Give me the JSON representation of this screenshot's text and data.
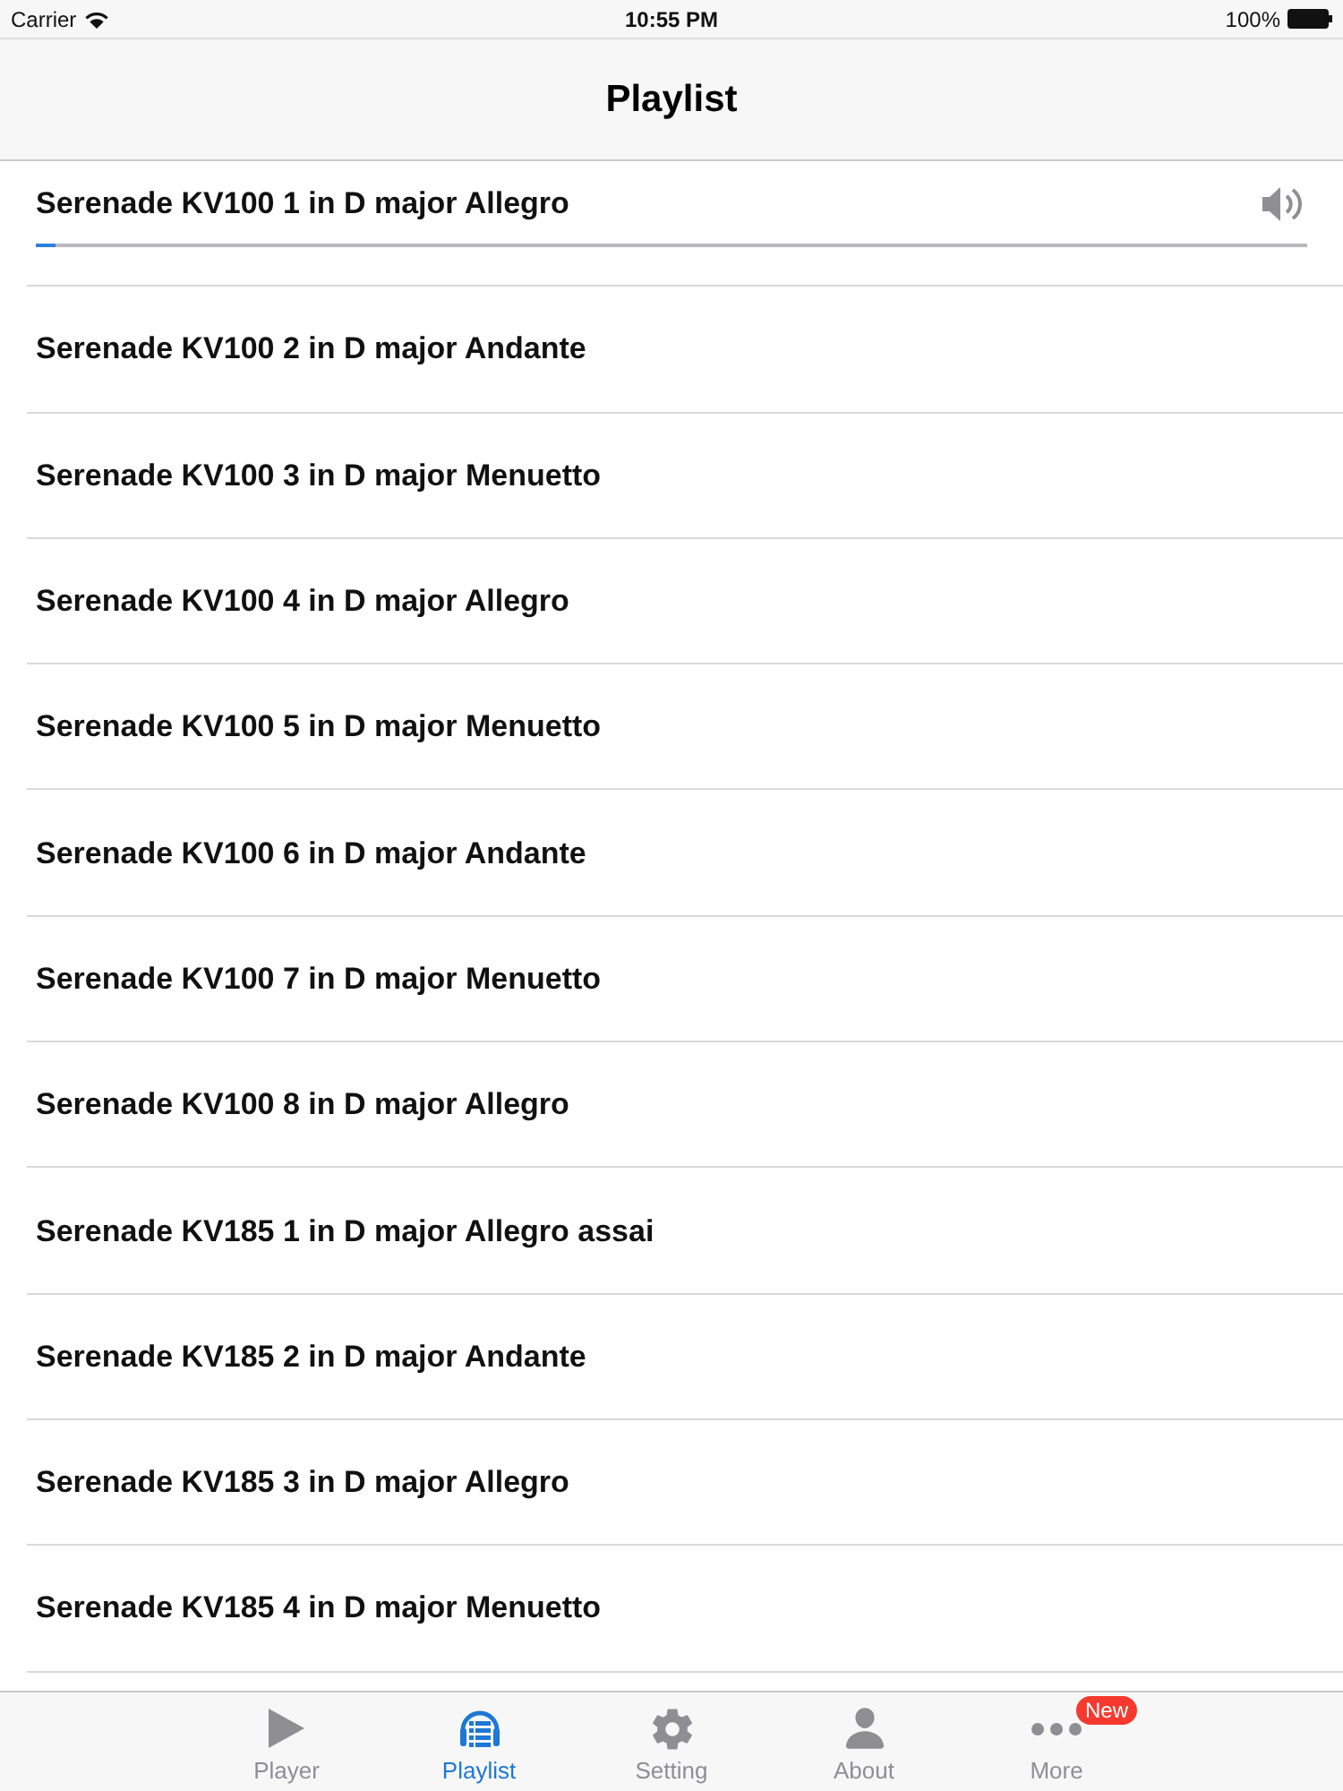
{
  "status_bar": {
    "carrier": "Carrier",
    "time": "10:55 PM",
    "battery": "100%"
  },
  "nav_bar": {
    "title": "Playlist"
  },
  "tracks": [
    {
      "title": "Serenade KV100 1 in D major Allegro",
      "playing": true,
      "level": 0.015
    },
    {
      "title": "Serenade KV100 2 in D major Andante",
      "playing": false
    },
    {
      "title": "Serenade KV100 3 in D major Menuetto",
      "playing": false
    },
    {
      "title": "Serenade KV100 4 in D major Allegro",
      "playing": false
    },
    {
      "title": "Serenade KV100 5 in D major Menuetto",
      "playing": false
    },
    {
      "title": "Serenade KV100 6 in D major Andante",
      "playing": false
    },
    {
      "title": "Serenade KV100 7 in D major Menuetto",
      "playing": false
    },
    {
      "title": "Serenade KV100 8 in D major Allegro",
      "playing": false
    },
    {
      "title": "Serenade KV185 1 in D major Allegro assai",
      "playing": false
    },
    {
      "title": "Serenade KV185 2 in D major Andante",
      "playing": false
    },
    {
      "title": "Serenade KV185 3 in D major Allegro",
      "playing": false
    },
    {
      "title": "Serenade KV185 4 in D major Menuetto",
      "playing": false
    }
  ],
  "tab_bar": {
    "items": [
      {
        "label": "Player",
        "selected": false
      },
      {
        "label": "Playlist",
        "selected": true
      },
      {
        "label": "Setting",
        "selected": false
      },
      {
        "label": "About",
        "selected": false
      },
      {
        "label": "More",
        "selected": false,
        "badge": "New"
      }
    ]
  }
}
